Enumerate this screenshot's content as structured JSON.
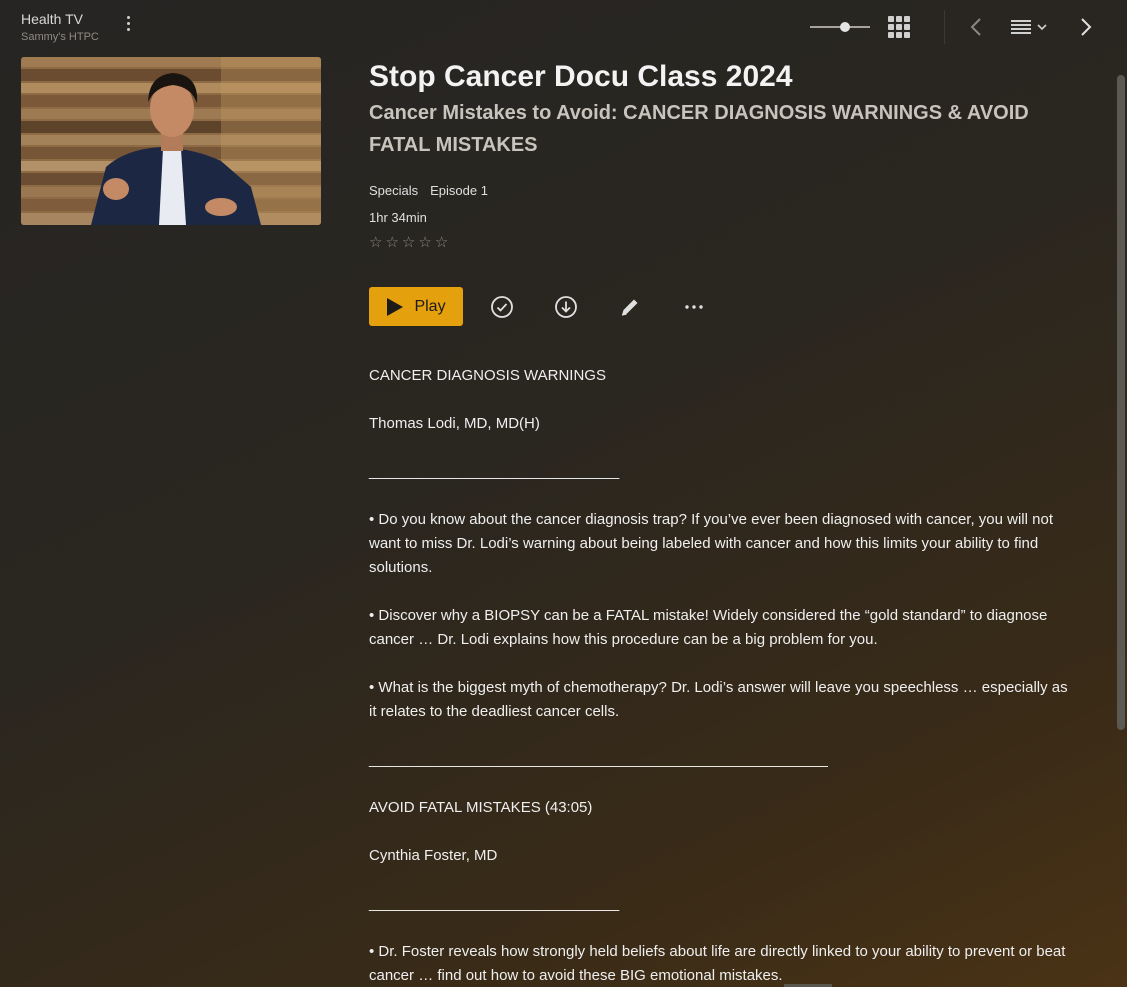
{
  "header": {
    "server_name": "Health TV",
    "server_sub": "Sammy's HTPC",
    "zoom_level": 0.6
  },
  "item": {
    "title": "Stop Cancer Docu Class 2024",
    "subtitle": "Cancer Mistakes to Avoid: CANCER DIAGNOSIS WARNINGS & AVOID FATAL MISTAKES",
    "season": "Specials",
    "episode": "Episode 1",
    "duration": "1hr 34min",
    "rating": 0,
    "stars": [
      "☆",
      "☆",
      "☆",
      "☆",
      "☆"
    ]
  },
  "actions": {
    "play_label": "Play"
  },
  "description": {
    "heading1": "CANCER DIAGNOSIS WARNINGS",
    "speaker1": "Thomas Lodi, MD, MD(H)",
    "rule1": "______________________________",
    "bullet1": "• Do you know about the cancer diagnosis trap? If you’ve ever been diagnosed with cancer, you will not want to miss Dr. Lodi’s warning about being labeled with cancer and how this limits your ability to find solutions.",
    "bullet2": "• Discover why a BIOPSY can be a FATAL mistake! Widely considered the “gold standard” to diagnose cancer … Dr. Lodi explains how this procedure can be a big problem for you.",
    "bullet3": "• What is the biggest myth of chemotherapy? Dr. Lodi’s answer will leave you speechless … especially as it relates to the deadliest cancer cells.",
    "rule2": "_______________________________________________________",
    "heading2": "AVOID FATAL MISTAKES (43:05)",
    "speaker2": "Cynthia Foster, MD",
    "rule3": "______________________________",
    "bullet4": "• Dr. Foster reveals how strongly held beliefs about life are directly linked to your ability to prevent or beat cancer … find out how to avoid these BIG emotional mistakes."
  },
  "icons": {
    "more": "kebab-vertical-icon",
    "grid": "grid-view-icon",
    "back": "chevron-left-icon",
    "list": "list-view-icon",
    "forward": "chevron-right-icon",
    "watched": "check-circle-icon",
    "download": "download-circle-icon",
    "edit": "pencil-icon",
    "more_actions": "ellipsis-icon"
  },
  "colors": {
    "accent": "#e5a00d",
    "background_dark": "#262523",
    "background_warm": "#4a3316"
  }
}
